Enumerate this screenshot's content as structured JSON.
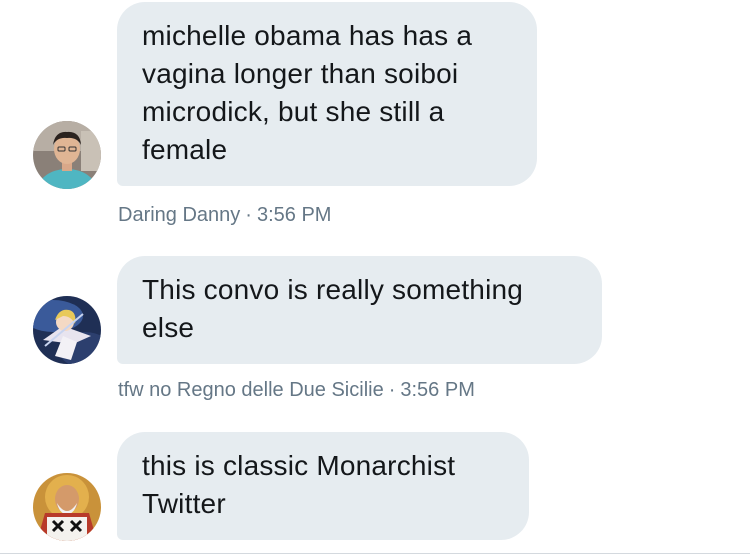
{
  "messages": [
    {
      "text": "michelle obama has has a vagina longer than soiboi microdick, but she still a female",
      "sender": "Daring Danny",
      "separator": "·",
      "time": "3:56 PM",
      "avatar_icon": "user-avatar-photo-icon"
    },
    {
      "text": "This convo is really something else",
      "sender": "tfw no Regno delle Due Sicilie",
      "separator": "·",
      "time": "3:56 PM",
      "avatar_icon": "anime-character-avatar-icon"
    },
    {
      "text": "this is classic Monarchist Twitter",
      "sender": "",
      "separator": "",
      "time": "",
      "avatar_icon": "saint-icon-avatar-icon"
    }
  ],
  "colors": {
    "bubble_bg": "#e6ecf0",
    "text": "#14171a",
    "meta_text": "#657786"
  }
}
